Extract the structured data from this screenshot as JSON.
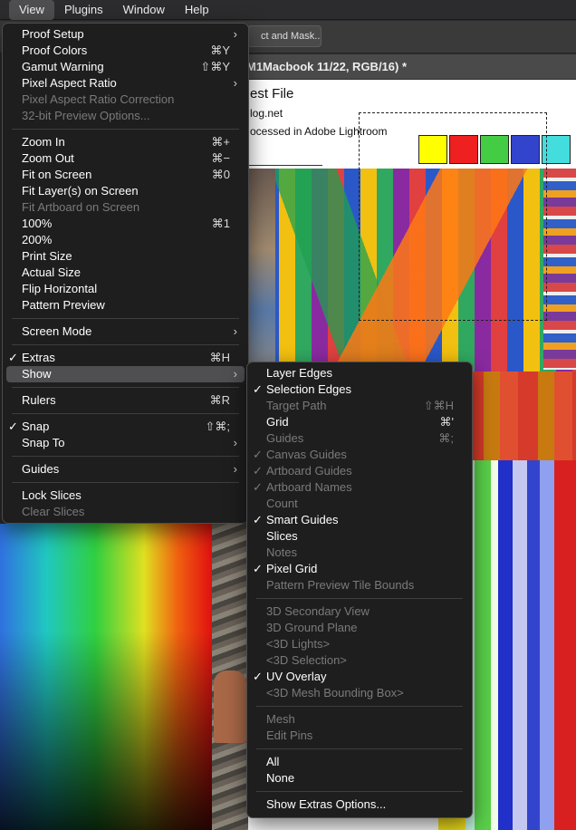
{
  "menubar": {
    "items": [
      "View",
      "Plugins",
      "Window",
      "Help"
    ]
  },
  "toolbar": {
    "refine_label": "ct and Mask..."
  },
  "document": {
    "tab_title": "M1Macbook 11/22, RGB/16) *",
    "title": "est File",
    "url": "log.net",
    "processed": "ocessed in Adobe Lightroom",
    "swatches": [
      "#ffff00",
      "#ee2020",
      "#44cc44",
      "#3344cc",
      "#44dddd"
    ]
  },
  "view_menu": {
    "items": [
      {
        "label": "Proof Setup",
        "submenu": true
      },
      {
        "label": "Proof Colors",
        "shortcut": "⌘Y"
      },
      {
        "label": "Gamut Warning",
        "shortcut": "⇧⌘Y"
      },
      {
        "label": "Pixel Aspect Ratio",
        "submenu": true
      },
      {
        "label": "Pixel Aspect Ratio Correction",
        "disabled": true
      },
      {
        "label": "32-bit Preview Options...",
        "disabled": true
      },
      {
        "separator": true
      },
      {
        "label": "Zoom In",
        "shortcut": "⌘+"
      },
      {
        "label": "Zoom Out",
        "shortcut": "⌘−"
      },
      {
        "label": "Fit on Screen",
        "shortcut": "⌘0"
      },
      {
        "label": "Fit Layer(s) on Screen"
      },
      {
        "label": "Fit Artboard on Screen",
        "disabled": true
      },
      {
        "label": "100%",
        "shortcut": "⌘1"
      },
      {
        "label": "200%"
      },
      {
        "label": "Print Size"
      },
      {
        "label": "Actual Size"
      },
      {
        "label": "Flip Horizontal"
      },
      {
        "label": "Pattern Preview"
      },
      {
        "separator": true
      },
      {
        "label": "Screen Mode",
        "submenu": true
      },
      {
        "separator": true
      },
      {
        "label": "Extras",
        "checked": true,
        "shortcut": "⌘H"
      },
      {
        "label": "Show",
        "submenu": true,
        "highlighted": true
      },
      {
        "separator": true
      },
      {
        "label": "Rulers",
        "shortcut": "⌘R"
      },
      {
        "separator": true
      },
      {
        "label": "Snap",
        "checked": true,
        "shortcut": "⇧⌘;"
      },
      {
        "label": "Snap To",
        "submenu": true
      },
      {
        "separator": true
      },
      {
        "label": "Guides",
        "submenu": true
      },
      {
        "separator": true
      },
      {
        "label": "Lock Slices"
      },
      {
        "label": "Clear Slices",
        "disabled": true
      }
    ]
  },
  "show_menu": {
    "items": [
      {
        "label": "Layer Edges"
      },
      {
        "label": "Selection Edges",
        "checked": true
      },
      {
        "label": "Target Path",
        "disabled": true,
        "shortcut": "⇧⌘H"
      },
      {
        "label": "Grid",
        "shortcut": "⌘'"
      },
      {
        "label": "Guides",
        "disabled": true,
        "shortcut": "⌘;"
      },
      {
        "label": "Canvas Guides",
        "disabled": true,
        "checked": true
      },
      {
        "label": "Artboard Guides",
        "disabled": true,
        "checked": true
      },
      {
        "label": "Artboard Names",
        "disabled": true,
        "checked": true
      },
      {
        "label": "Count",
        "disabled": true
      },
      {
        "label": "Smart Guides",
        "checked": true
      },
      {
        "label": "Slices"
      },
      {
        "label": "Notes",
        "disabled": true
      },
      {
        "label": "Pixel Grid",
        "checked": true
      },
      {
        "label": "Pattern Preview Tile Bounds",
        "disabled": true
      },
      {
        "separator": true
      },
      {
        "label": "3D Secondary View",
        "disabled": true
      },
      {
        "label": "3D Ground Plane",
        "disabled": true
      },
      {
        "label": "<3D Lights>",
        "disabled": true
      },
      {
        "label": "<3D Selection>",
        "disabled": true
      },
      {
        "label": "UV Overlay",
        "checked": true
      },
      {
        "label": "<3D Mesh Bounding Box>",
        "disabled": true
      },
      {
        "separator": true
      },
      {
        "label": "Mesh",
        "disabled": true
      },
      {
        "label": "Edit Pins",
        "disabled": true
      },
      {
        "separator": true
      },
      {
        "label": "All"
      },
      {
        "label": "None"
      },
      {
        "separator": true
      },
      {
        "label": "Show Extras Options..."
      }
    ]
  },
  "icons": {
    "check": "checkmark-icon",
    "submenu": "chevron-right-icon"
  }
}
